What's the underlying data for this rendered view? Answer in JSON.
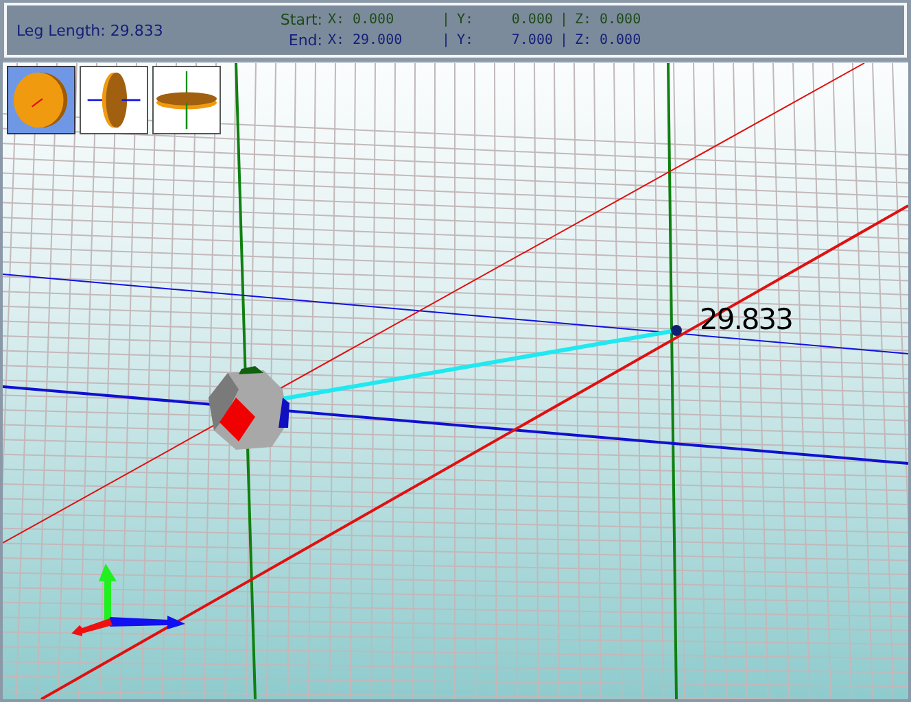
{
  "header": {
    "leg_label": "Leg Length: 29.833",
    "rows": [
      {
        "kind": "start",
        "label": "Start:",
        "separator": "|",
        "fields": [
          {
            "axis": "X:",
            "value": "0.000"
          },
          {
            "axis": "Y:",
            "value": "0.000"
          },
          {
            "axis": "Z:",
            "value": "0.000"
          }
        ]
      },
      {
        "kind": "end",
        "label": "End:",
        "separator": "|",
        "fields": [
          {
            "axis": "X:",
            "value": "29.000"
          },
          {
            "axis": "Y:",
            "value": "7.000"
          },
          {
            "axis": "Z:",
            "value": "0.000"
          }
        ]
      }
    ]
  },
  "view_buttons": [
    {
      "kind": "front",
      "selected": true
    },
    {
      "kind": "side",
      "selected": false
    },
    {
      "kind": "top",
      "selected": false
    }
  ],
  "scene": {
    "measurement": "29.833"
  }
}
